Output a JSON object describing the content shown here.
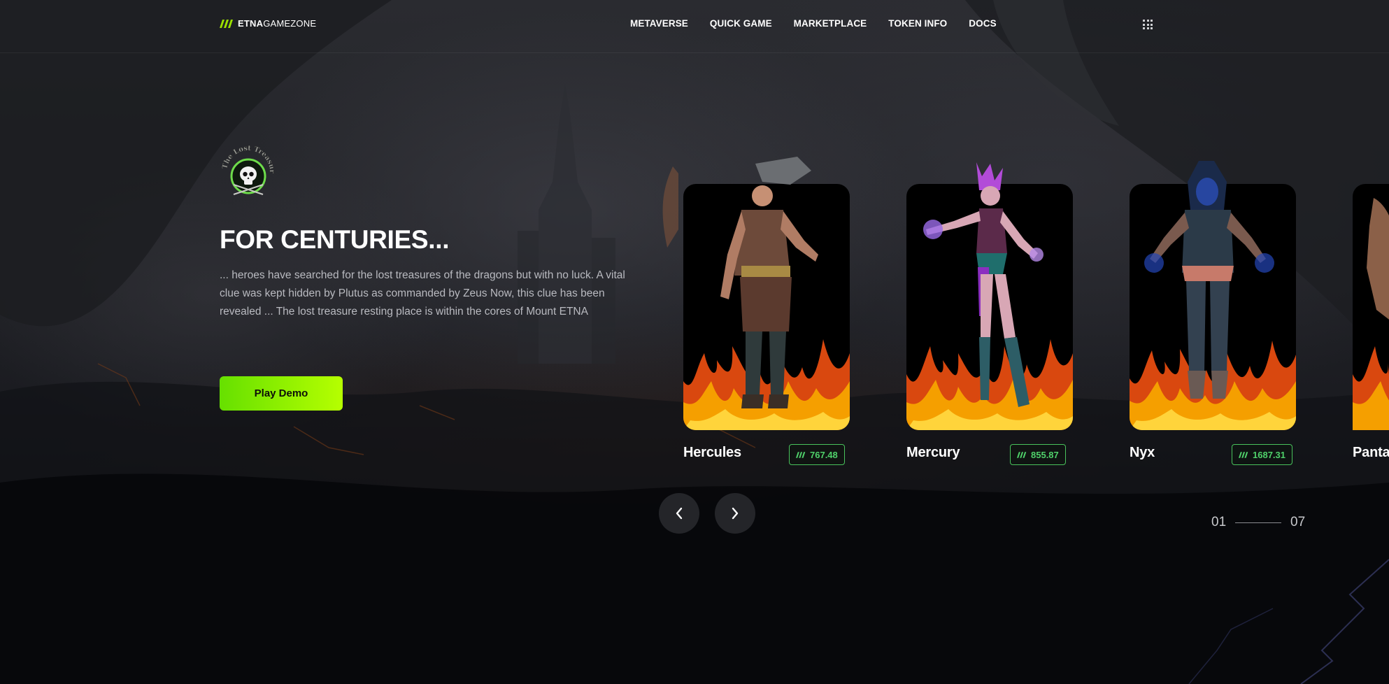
{
  "header": {
    "brand_bold": "ETNA",
    "brand_light": "GAMEZONE",
    "nav": [
      {
        "label": "METAVERSE"
      },
      {
        "label": "QUICK GAME"
      },
      {
        "label": "MARKETPLACE"
      },
      {
        "label": "TOKEN INFO"
      },
      {
        "label": "DOCS"
      }
    ],
    "menu_icon": "grid-icon"
  },
  "hero": {
    "badge_text": "The Lost Treasure",
    "title": "FOR CENTURIES...",
    "description": "... heroes have searched for the lost treasures of the dragons but with no luck. A vital clue was kept hidden by Plutus as commanded by Zeus Now, this clue has been revealed ... The lost treasure resting place is within the cores of Mount ETNA",
    "cta_label": "Play Demo"
  },
  "carousel": {
    "cards": [
      {
        "name": "Hercules",
        "price": "767.48",
        "price_icon": "etna-token-icon"
      },
      {
        "name": "Mercury",
        "price": "855.87",
        "price_icon": "etna-token-icon"
      },
      {
        "name": "Nyx",
        "price": "1687.31",
        "price_icon": "etna-token-icon"
      },
      {
        "name": "Panta",
        "price": "",
        "price_icon": "etna-token-icon"
      }
    ],
    "prev_icon": "chevron-left-icon",
    "next_icon": "chevron-right-icon",
    "pager_current": "01",
    "pager_total": "07"
  },
  "colors": {
    "accent_start": "#66e000",
    "accent_end": "#b6ff00",
    "price_green": "#4fd06a",
    "background": "#0b0c0f"
  }
}
